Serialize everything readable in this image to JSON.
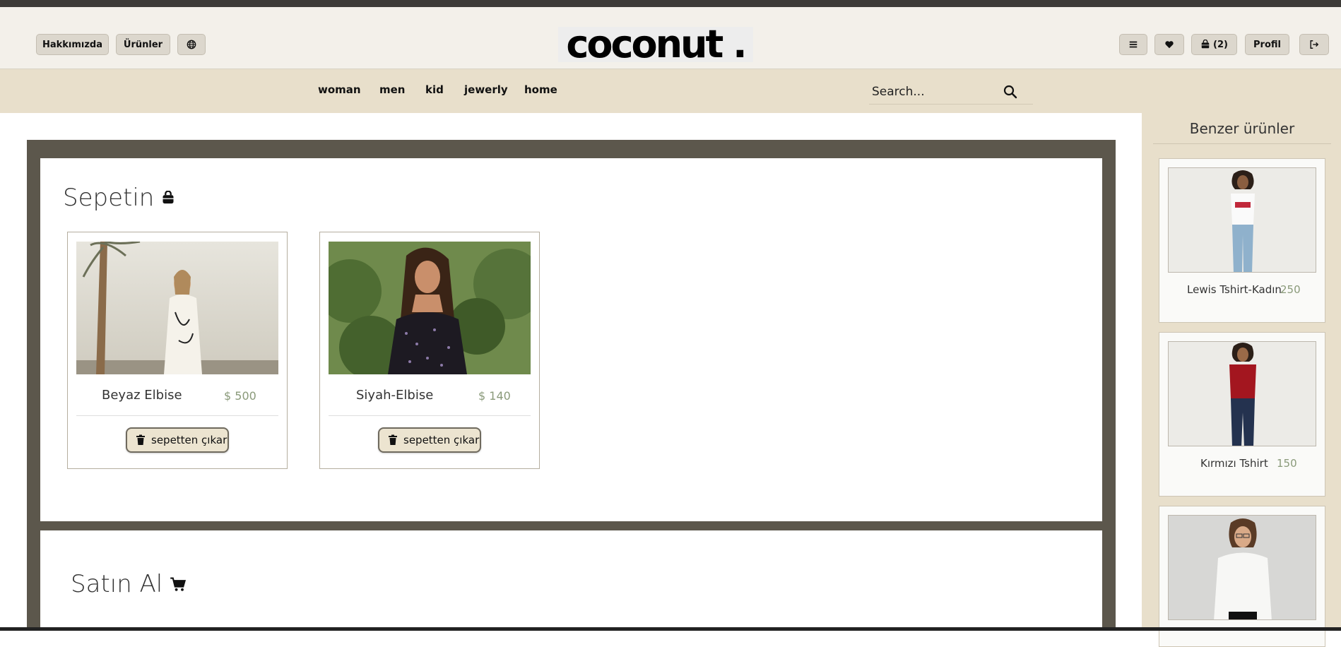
{
  "header": {
    "about_label": "Hakkımızda",
    "products_label": "Ürünler",
    "logo_text": "coconut .",
    "cart_count_label": "(2)",
    "profile_label": "Profil"
  },
  "nav": {
    "links": [
      "woman",
      "men",
      "kid",
      "jewerly",
      "home"
    ],
    "search_placeholder": "Search..."
  },
  "cart": {
    "title": "Sepetin",
    "items": [
      {
        "name": "Beyaz Elbise",
        "price": "$ 500",
        "remove_label": "sepetten çıkar"
      },
      {
        "name": "Siyah-Elbise",
        "price": "$ 140",
        "remove_label": "sepetten çıkar"
      }
    ]
  },
  "checkout": {
    "title": "Satın Al"
  },
  "similar": {
    "title": "Benzer ürünler",
    "items": [
      {
        "name": "Lewis Tshirt-Kadın",
        "price": "250"
      },
      {
        "name": "Kırmızı Tshirt",
        "price": "150"
      },
      {
        "name": "",
        "price": ""
      }
    ]
  },
  "colors": {
    "header_bg": "#f3f0ea",
    "nav_bg": "#e8dfcb",
    "panel_frame": "#5c574c",
    "price_color": "#8a9a7a"
  }
}
